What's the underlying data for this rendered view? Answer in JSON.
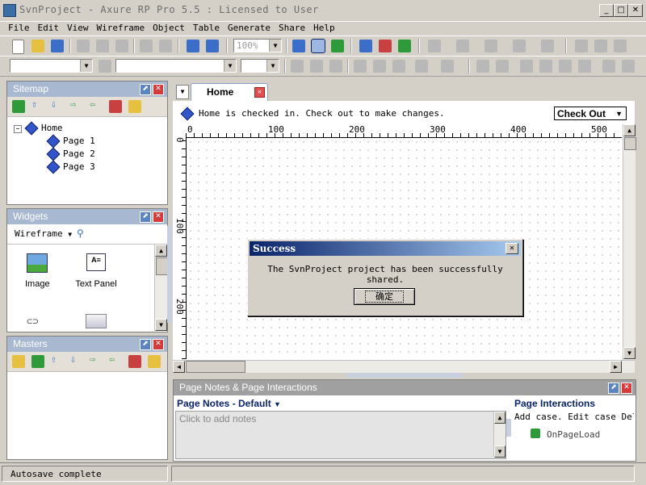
{
  "window": {
    "title": "SvnProject - Axure RP Pro 5.5 : Licensed to User",
    "btn_min": "_",
    "btn_max": "□",
    "btn_close": "✕"
  },
  "menu": [
    "File",
    "Edit",
    "View",
    "Wireframe",
    "Object",
    "Table",
    "Generate",
    "Share",
    "Help"
  ],
  "toolbar": {
    "zoom": "100%"
  },
  "sitemap": {
    "title": "Sitemap",
    "root": "Home",
    "pages": [
      "Page 1",
      "Page 2",
      "Page 3"
    ]
  },
  "widgets": {
    "title": "Widgets",
    "library": "Wireframe",
    "items": [
      "Image",
      "Text Panel"
    ]
  },
  "masters": {
    "title": "Masters"
  },
  "editor": {
    "tab": "Home",
    "info": "Home is checked in. Check out to make changes.",
    "checkout_label": "Check Out",
    "ruler_h": [
      "0",
      "100",
      "200",
      "300",
      "400",
      "500"
    ],
    "ruler_v": [
      "0",
      "100",
      "200"
    ]
  },
  "dialog": {
    "title": "Success",
    "message": "The SvnProject project has been successfully shared.",
    "ok": "确定"
  },
  "notes": {
    "title": "Page Notes & Page Interactions",
    "notes_header": "Page Notes - Default",
    "placeholder": "Click to add notes",
    "interactions_header": "Page Interactions",
    "interactions_links": "Add case. Edit case Delet",
    "event": "OnPageLoad"
  },
  "status": {
    "text": "Autosave complete"
  },
  "colors": {
    "panel_header": "#a8b8d0",
    "dialog_title": "#0a246a",
    "window_bg": "#d4d0c8"
  }
}
